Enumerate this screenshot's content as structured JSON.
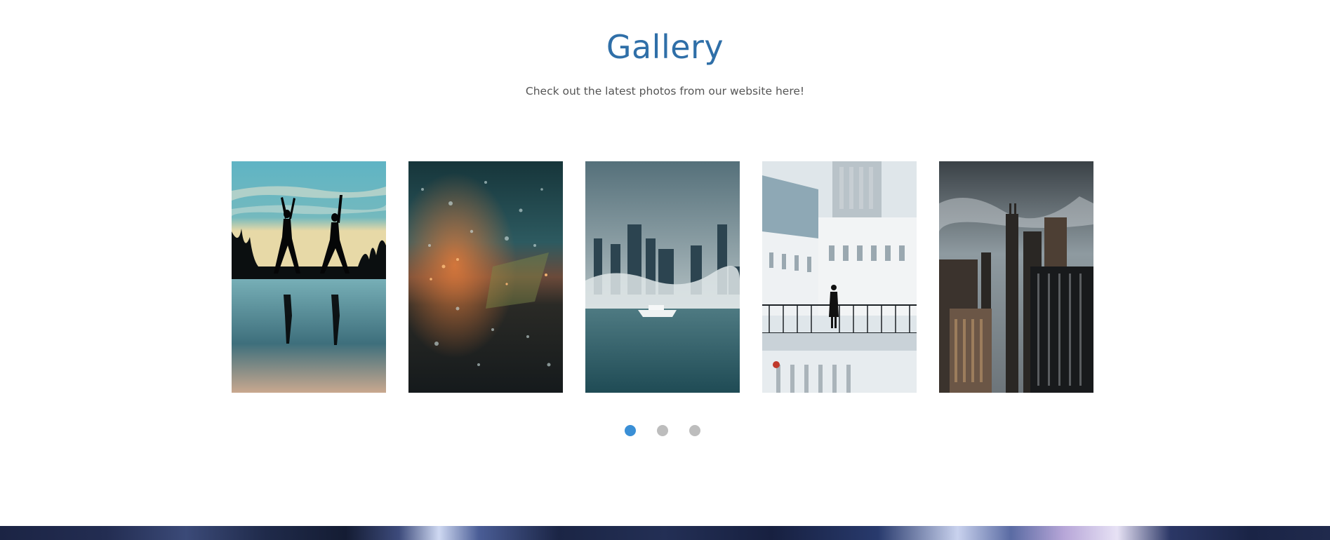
{
  "section": {
    "title": "Gallery",
    "subtitle": "Check out the latest photos from our website here!"
  },
  "carousel": {
    "slides": [
      {
        "alt": "Two people doing yoga silhouetted at sunset by the water"
      },
      {
        "alt": "Raindrops on a window with blurred city lights"
      },
      {
        "alt": "City skyline in fog with a boat on the water"
      },
      {
        "alt": "Woman standing on a bridge in front of white buildings"
      },
      {
        "alt": "Tall city skyscrapers under a cloudy sky"
      }
    ],
    "active_page": 1,
    "page_count": 3
  },
  "colors": {
    "title": "#2f6fa8",
    "subtitle": "#555555",
    "dot_active": "#3a8fd6",
    "dot_inactive": "#bdbdbd"
  }
}
